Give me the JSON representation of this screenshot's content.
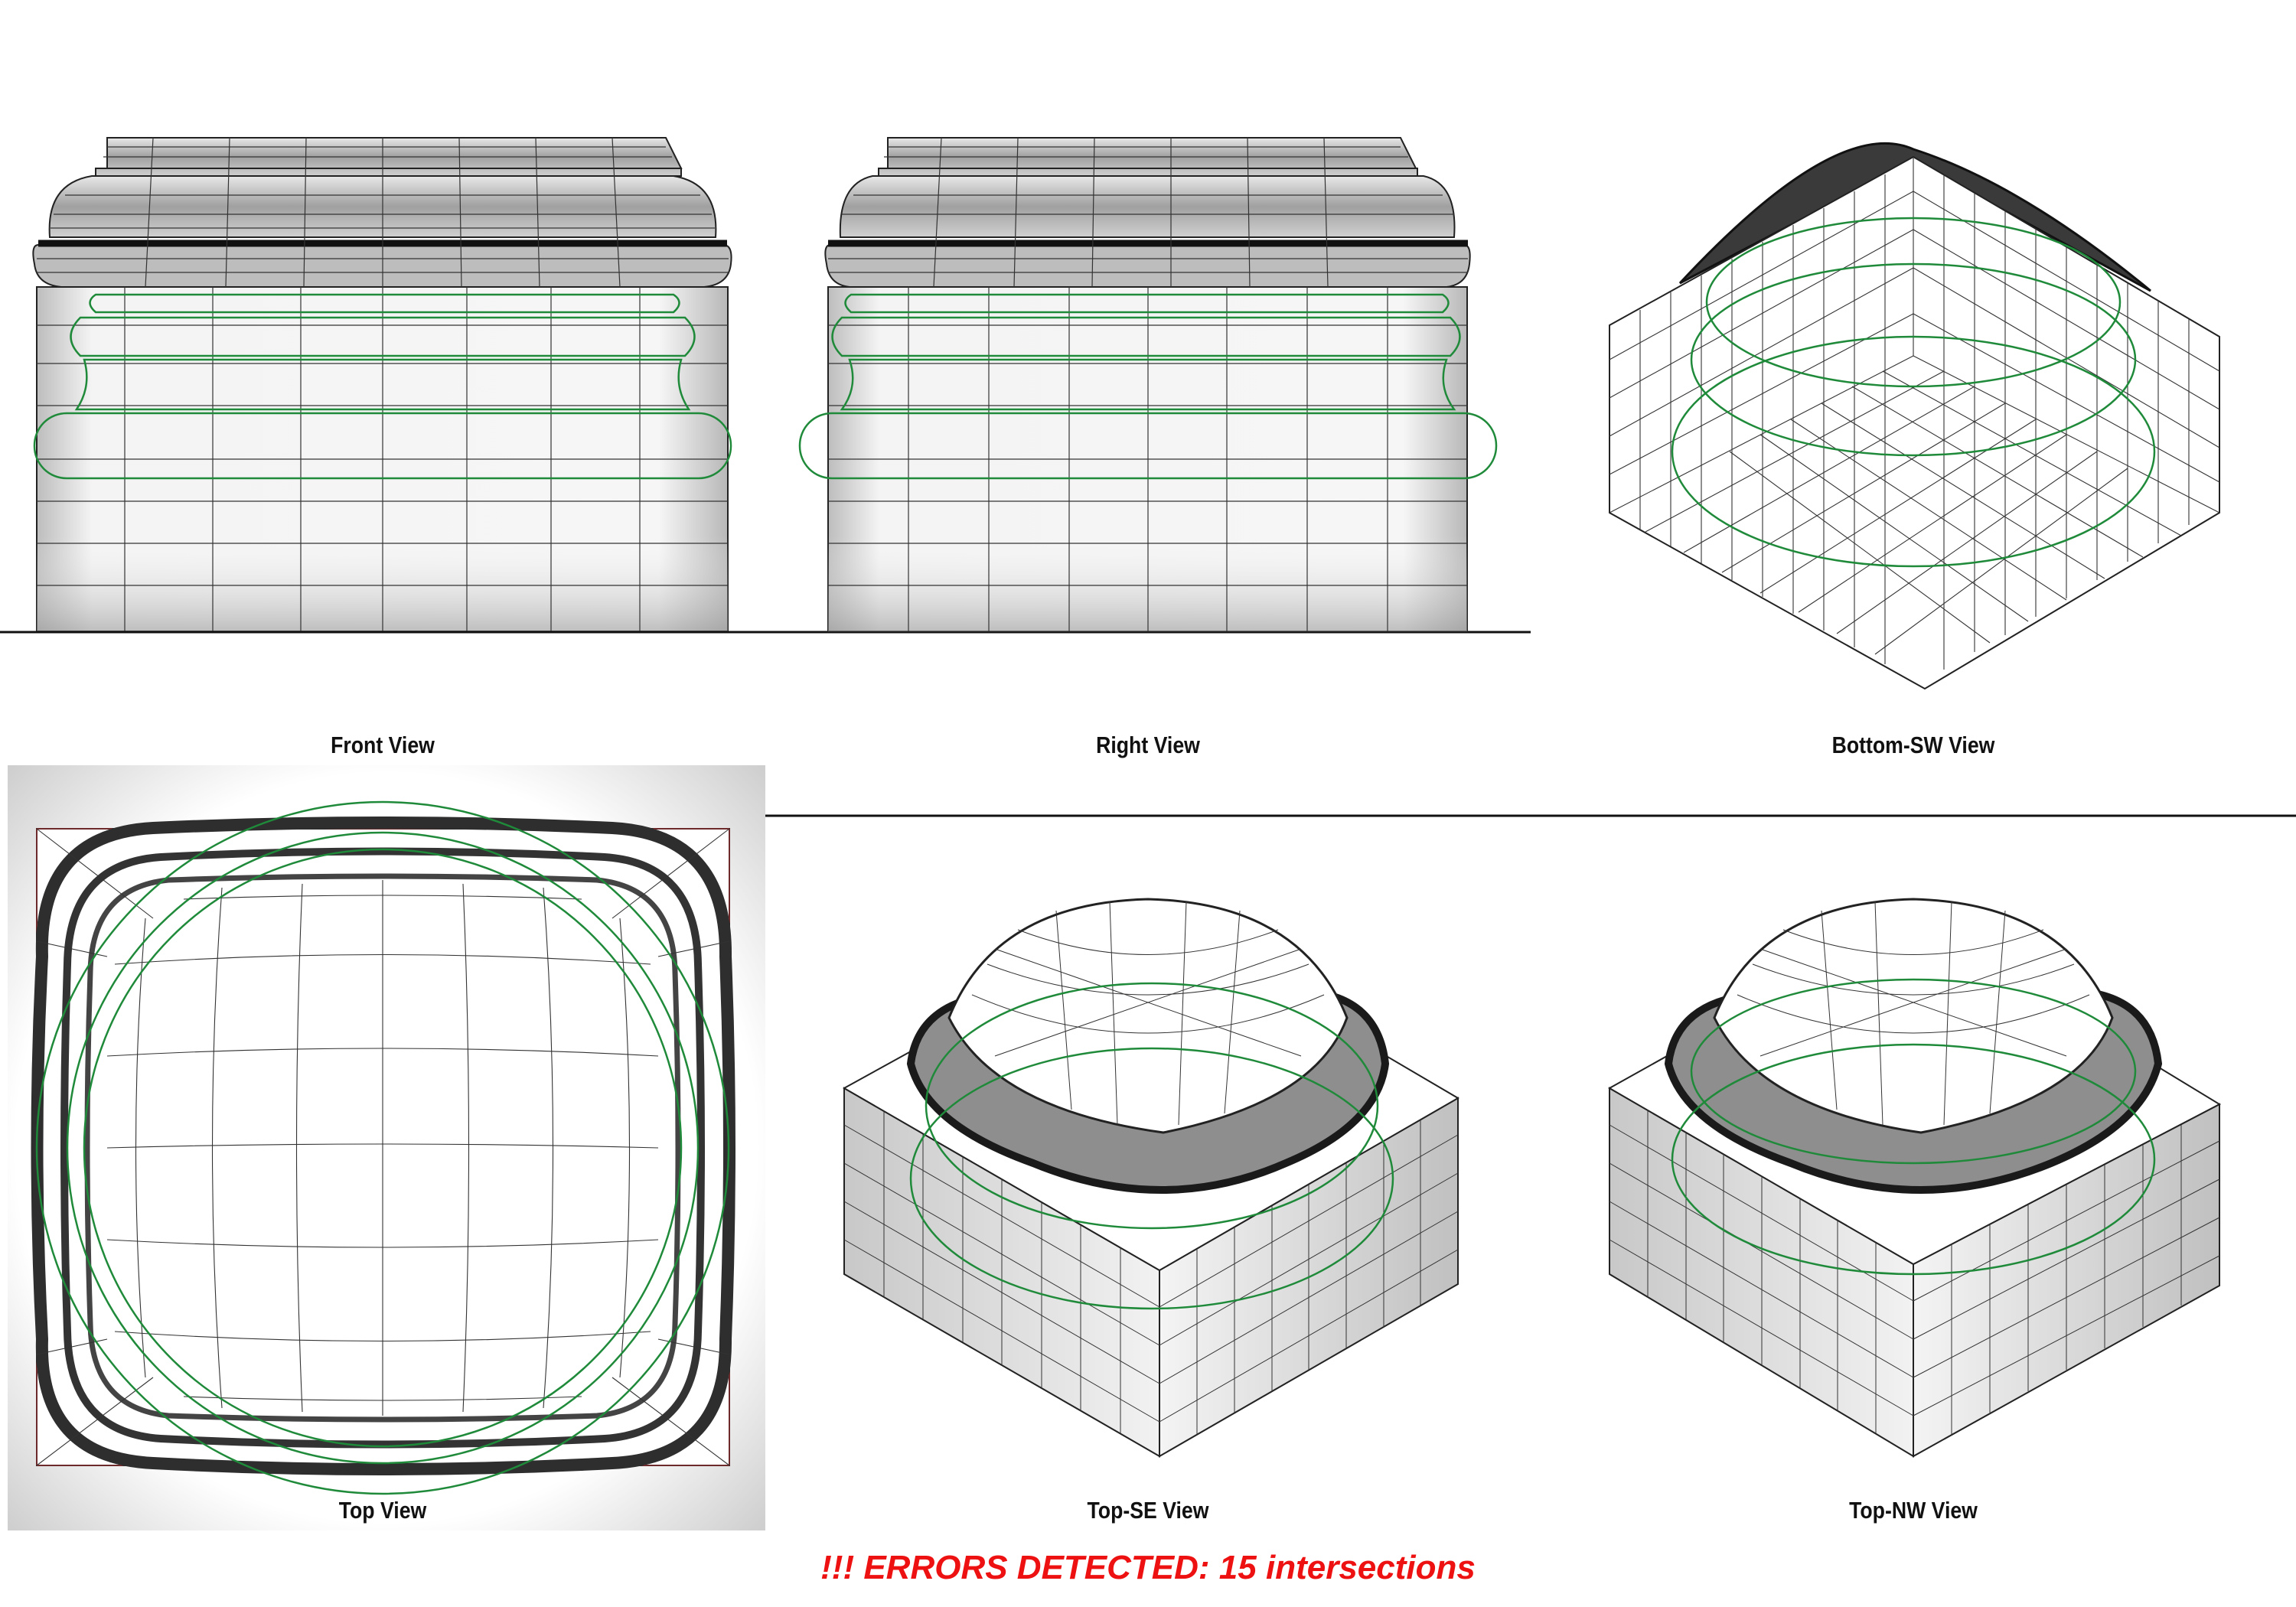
{
  "views": {
    "front": {
      "label": "Front View"
    },
    "right": {
      "label": "Right View"
    },
    "bottom_sw": {
      "label": "Bottom-SW View"
    },
    "top": {
      "label": "Top View"
    },
    "top_se": {
      "label": "Top-SE View"
    },
    "top_nw": {
      "label": "Top-NW View"
    }
  },
  "status": {
    "error_message": "!!! ERRORS DETECTED: 15 intersections"
  },
  "colors": {
    "mesh_line": "#222222",
    "curve_green": "#1f8a3a",
    "error_text": "#ee1111",
    "shade_gray": "#d8d8d8"
  }
}
